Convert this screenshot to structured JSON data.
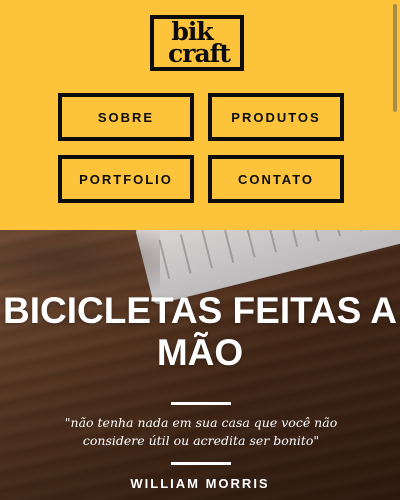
{
  "header": {
    "logo": {
      "line1": "bik",
      "line2": "craft"
    },
    "nav": [
      {
        "label": "SOBRE"
      },
      {
        "label": "PRODUTOS"
      },
      {
        "label": "PORTFOLIO"
      },
      {
        "label": "CONTATO"
      }
    ]
  },
  "hero": {
    "title": "BICICLETAS FEITAS A MÃO",
    "quote": "\"não tenha nada em sua casa que você não considere útil ou acredita ser bonito\"",
    "author": "WILLIAM MORRIS"
  },
  "colors": {
    "header_bg": "#fcc33b",
    "ink": "#0c0c0c",
    "hero_text": "#ffffff"
  }
}
